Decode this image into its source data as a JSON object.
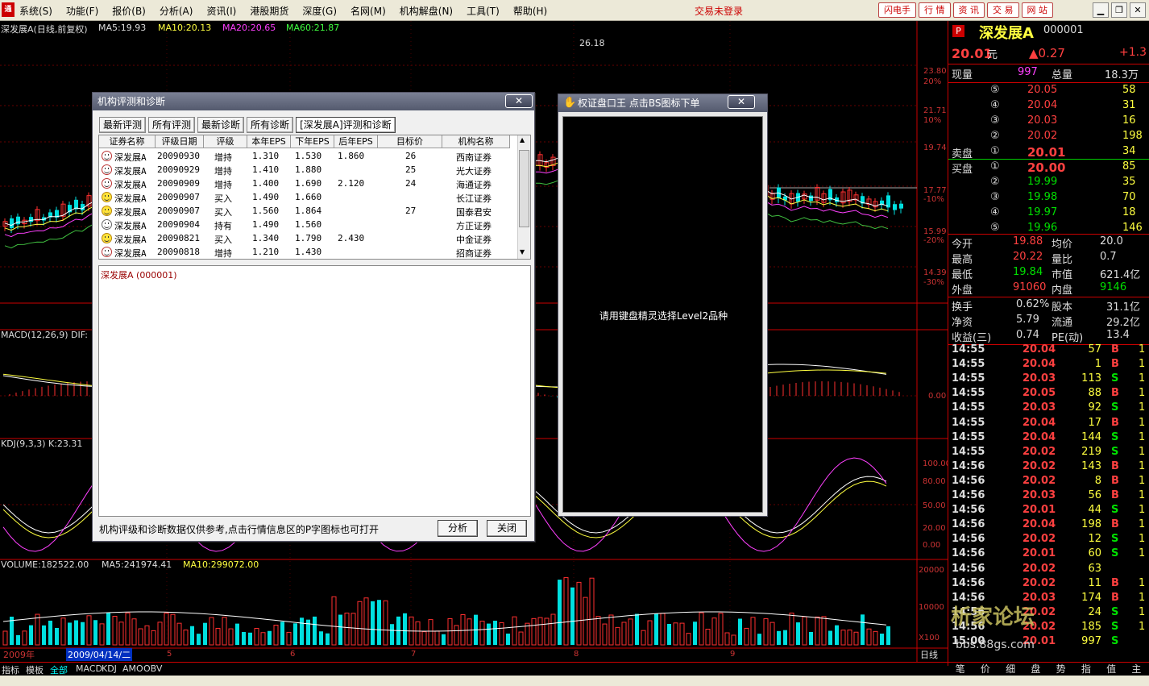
{
  "menu": [
    "系统(S)",
    "功能(F)",
    "报价(B)",
    "分析(A)",
    "资讯(I)",
    "港股期货",
    "深度(G)",
    "名网(M)",
    "机构解盘(N)",
    "工具(T)",
    "帮助(H)"
  ],
  "login_status": "交易未登录",
  "quick_buttons": [
    "闪电手",
    "行 情",
    "资 讯",
    "交 易",
    "网 站"
  ],
  "chart": {
    "title": "深发展A(日线,前复权)",
    "ma5": "MA5:19.93",
    "ma10": "MA10:20.13",
    "ma20": "MA20:20.65",
    "ma60": "MA60:21.87",
    "high_label": "26.18",
    "price_axis": [
      "23.80",
      "20%",
      "21.71",
      "10%",
      "19.74",
      "17.77",
      "-10%",
      "15.99",
      "-20%",
      "14.39",
      "-30%"
    ],
    "macd_label": "MACD(12,26,9) DIF:",
    "macd_axis": [
      "0.00"
    ],
    "kdj_label": "KDJ(9,3,3) K:23.31",
    "kdj_axis": [
      "100.00",
      "80.00",
      "50.00",
      "20.00",
      "0.00"
    ],
    "vol_label": "VOLUME:182522.00",
    "vol_ma5": "MA5:241974.41",
    "vol_ma10": "MA10:299072.00",
    "vol_axis": [
      "20000",
      "10000",
      "X100"
    ],
    "x_year": "2009年",
    "x_cursor": "2009/04/14/二",
    "x_months": [
      "5",
      "6",
      "7",
      "8",
      "9"
    ],
    "period": "日线"
  },
  "bottom_tabs": [
    "指标",
    "模板",
    "全部",
    "MACD",
    "KDJ",
    "AMO",
    "OBV"
  ],
  "quote": {
    "badge": "P",
    "name": "深发展A",
    "code": "000001",
    "price": "20.01",
    "unit": "元",
    "change": "▲0.27",
    "pct": "+1.3",
    "now_vol_label": "现量",
    "now_vol": "997",
    "total_label": "总量",
    "total": "18.3万",
    "sell_label": "卖盘",
    "buy_label": "买盘",
    "sells": [
      {
        "lv": "⑤",
        "price": "20.05",
        "vol": "58"
      },
      {
        "lv": "④",
        "price": "20.04",
        "vol": "31"
      },
      {
        "lv": "③",
        "price": "20.03",
        "vol": "16"
      },
      {
        "lv": "②",
        "price": "20.02",
        "vol": "198"
      },
      {
        "lv": "①",
        "price": "20.01",
        "vol": "34"
      }
    ],
    "buys": [
      {
        "lv": "①",
        "price": "20.00",
        "vol": "85"
      },
      {
        "lv": "②",
        "price": "19.99",
        "vol": "35"
      },
      {
        "lv": "③",
        "price": "19.98",
        "vol": "70"
      },
      {
        "lv": "④",
        "price": "19.97",
        "vol": "18"
      },
      {
        "lv": "⑤",
        "price": "19.96",
        "vol": "146"
      }
    ],
    "stats": [
      {
        "l1": "今开",
        "v1": "19.88",
        "l2": "均价",
        "v2": "20.0"
      },
      {
        "l1": "最高",
        "v1": "20.22",
        "l2": "量比",
        "v2": "0.7"
      },
      {
        "l1": "最低",
        "v1": "19.84",
        "l2": "市值",
        "v2": "621.4亿"
      },
      {
        "l1": "外盘",
        "v1": "91060",
        "l2": "内盘",
        "v2": "9146"
      }
    ],
    "stats2": [
      {
        "l1": "换手",
        "v1": "0.62%",
        "l2": "股本",
        "v2": "31.1亿"
      },
      {
        "l1": "净资",
        "v1": "5.79",
        "l2": "流通",
        "v2": "29.2亿"
      },
      {
        "l1": "收益(三)",
        "v1": "0.74",
        "l2": "PE(动)",
        "v2": "13.4"
      }
    ],
    "ticks": [
      {
        "t": "14:55",
        "p": "20.04",
        "v": "57",
        "d": "B",
        "n": "1"
      },
      {
        "t": "14:55",
        "p": "20.04",
        "v": "1",
        "d": "B",
        "n": "1"
      },
      {
        "t": "14:55",
        "p": "20.03",
        "v": "113",
        "d": "S",
        "n": "1"
      },
      {
        "t": "14:55",
        "p": "20.05",
        "v": "88",
        "d": "B",
        "n": "1"
      },
      {
        "t": "14:55",
        "p": "20.03",
        "v": "92",
        "d": "S",
        "n": "1"
      },
      {
        "t": "14:55",
        "p": "20.04",
        "v": "17",
        "d": "B",
        "n": "1"
      },
      {
        "t": "14:55",
        "p": "20.04",
        "v": "144",
        "d": "S",
        "n": "1"
      },
      {
        "t": "14:55",
        "p": "20.02",
        "v": "219",
        "d": "S",
        "n": "1"
      },
      {
        "t": "14:56",
        "p": "20.02",
        "v": "143",
        "d": "B",
        "n": "1"
      },
      {
        "t": "14:56",
        "p": "20.02",
        "v": "8",
        "d": "B",
        "n": "1"
      },
      {
        "t": "14:56",
        "p": "20.03",
        "v": "56",
        "d": "B",
        "n": "1"
      },
      {
        "t": "14:56",
        "p": "20.01",
        "v": "44",
        "d": "S",
        "n": "1"
      },
      {
        "t": "14:56",
        "p": "20.04",
        "v": "198",
        "d": "B",
        "n": "1"
      },
      {
        "t": "14:56",
        "p": "20.02",
        "v": "12",
        "d": "S",
        "n": "1"
      },
      {
        "t": "14:56",
        "p": "20.01",
        "v": "60",
        "d": "S",
        "n": "1"
      },
      {
        "t": "14:56",
        "p": "20.02",
        "v": "63",
        "d": "",
        "n": ""
      },
      {
        "t": "14:56",
        "p": "20.02",
        "v": "11",
        "d": "B",
        "n": "1"
      },
      {
        "t": "14:56",
        "p": "20.03",
        "v": "174",
        "d": "B",
        "n": "1"
      },
      {
        "t": "14:56",
        "p": "20.02",
        "v": "24",
        "d": "S",
        "n": "1"
      },
      {
        "t": "14:56",
        "p": "20.02",
        "v": "185",
        "d": "S",
        "n": "1"
      },
      {
        "t": "15:00",
        "p": "20.01",
        "v": "997",
        "d": "S",
        "n": ""
      }
    ],
    "right_tabs": [
      "笔",
      "价",
      "细",
      "盘",
      "势",
      "指",
      "值",
      "主"
    ]
  },
  "dialog1": {
    "title": "机构评测和诊断",
    "tabs": [
      "最新评测",
      "所有评测",
      "最新诊断",
      "所有诊断",
      "[深发展A]评测和诊断"
    ],
    "columns": [
      "证券名称",
      "评级日期",
      "评级",
      "本年EPS",
      "下年EPS",
      "后年EPS",
      "目标价",
      "机构名称"
    ],
    "rows": [
      {
        "name": "深发展A",
        "date": "20090930",
        "rating": "增持",
        "eps1": "1.310",
        "eps2": "1.530",
        "eps3": "1.860",
        "target": "26",
        "org": "西南证券",
        "face": "red"
      },
      {
        "name": "深发展A",
        "date": "20090929",
        "rating": "增持",
        "eps1": "1.410",
        "eps2": "1.880",
        "eps3": "",
        "target": "25",
        "org": "光大证券",
        "face": "red"
      },
      {
        "name": "深发展A",
        "date": "20090909",
        "rating": "增持",
        "eps1": "1.400",
        "eps2": "1.690",
        "eps3": "2.120",
        "target": "24",
        "org": "海通证券",
        "face": "red"
      },
      {
        "name": "深发展A",
        "date": "20090907",
        "rating": "买入",
        "eps1": "1.490",
        "eps2": "1.660",
        "eps3": "",
        "target": "",
        "org": "长江证券",
        "face": "yellow"
      },
      {
        "name": "深发展A",
        "date": "20090907",
        "rating": "买入",
        "eps1": "1.560",
        "eps2": "1.864",
        "eps3": "",
        "target": "27",
        "org": "国泰君安",
        "face": "yellow"
      },
      {
        "name": "深发展A",
        "date": "20090904",
        "rating": "持有",
        "eps1": "1.490",
        "eps2": "1.560",
        "eps3": "",
        "target": "",
        "org": "方正证券",
        "face": "white"
      },
      {
        "name": "深发展A",
        "date": "20090821",
        "rating": "买入",
        "eps1": "1.340",
        "eps2": "1.790",
        "eps3": "2.430",
        "target": "",
        "org": "中金证券",
        "face": "yellow"
      },
      {
        "name": "深发展A",
        "date": "20090818",
        "rating": "增持",
        "eps1": "1.210",
        "eps2": "1.430",
        "eps3": "",
        "target": "",
        "org": "招商证券",
        "face": "red"
      }
    ],
    "detail_title": "深发展A (000001)",
    "note": "机构评级和诊断数据仅供参考,点击行情信息区的P字图标也可打开",
    "analyze": "分析",
    "close": "关闭"
  },
  "dialog2": {
    "title": "权证盘口王 点击BS图标下单",
    "message": "请用键盘精灵选择Level2品种"
  },
  "watermark": "析家论坛",
  "watermark_url": "bbs.88gs.com",
  "colors": {
    "up": "#ff3030",
    "down": "#00e0e0",
    "panel_border": "#c00000"
  }
}
